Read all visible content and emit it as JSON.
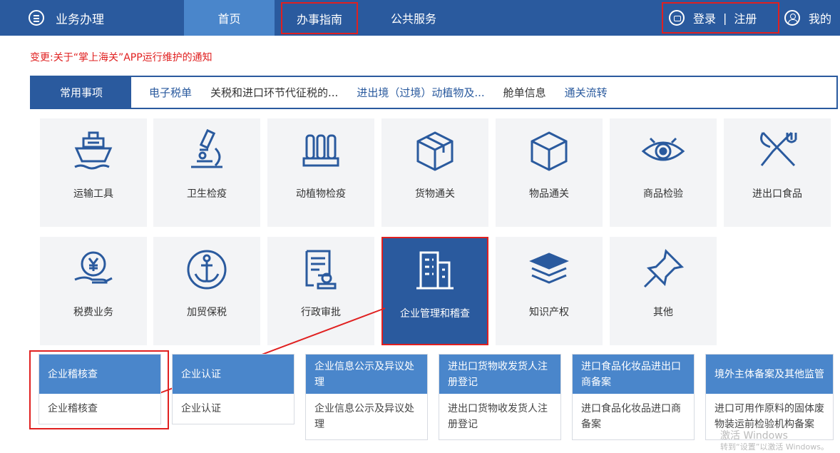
{
  "topnav": {
    "brand": "业务办理",
    "home": "首页",
    "guide": "办事指南",
    "public": "公共服务",
    "login": "登录",
    "separator": "|",
    "register": "注册",
    "mine": "我的"
  },
  "notice": "变更:关于“掌上海关”APP运行维护的通知",
  "tabs": [
    "常用事项",
    "电子税单",
    "关税和进口环节代征税的...",
    "进出境（过境）动植物及...",
    "舱单信息",
    "通关流转"
  ],
  "tiles": [
    {
      "label": "运输工具",
      "icon": "ship-icon"
    },
    {
      "label": "卫生检疫",
      "icon": "microscope-icon"
    },
    {
      "label": "动植物检疫",
      "icon": "quarantine-icon"
    },
    {
      "label": "货物通关",
      "icon": "package-icon"
    },
    {
      "label": "物品通关",
      "icon": "cube-icon"
    },
    {
      "label": "商品检验",
      "icon": "eye-icon"
    },
    {
      "label": "进出口食品",
      "icon": "fork-knife-icon"
    },
    {
      "label": "税费业务",
      "icon": "yen-hand-icon"
    },
    {
      "label": "加贸保税",
      "icon": "anchor-icon"
    },
    {
      "label": "行政审批",
      "icon": "document-stamp-icon"
    },
    {
      "label": "企业管理和稽查",
      "icon": "building-icon"
    },
    {
      "label": "知识产权",
      "icon": "books-icon"
    },
    {
      "label": "其他",
      "icon": "pin-icon"
    }
  ],
  "cards": [
    {
      "head": "企业稽核查",
      "body": "企业稽核查"
    },
    {
      "head": "企业认证",
      "body": "企业认证"
    },
    {
      "head": "企业信息公示及异议处理",
      "body": "企业信息公示及异议处理"
    },
    {
      "head": "进出口货物收发货人注册登记",
      "body": "进出口货物收发货人注册登记"
    },
    {
      "head": "进口食品化妆品进出口商备案",
      "body": "进口食品化妆品进口商备案"
    },
    {
      "head": "境外主体备案及其他监管",
      "body": "进口可用作原料的固体废物装运前检验机构备案"
    }
  ],
  "watermark": {
    "line1": "激活 Windows",
    "line2": "转到“设置”以激活 Windows。"
  },
  "colors": {
    "primary": "#2a5a9e",
    "accent": "#4a86cb",
    "highlight": "#e02020"
  }
}
